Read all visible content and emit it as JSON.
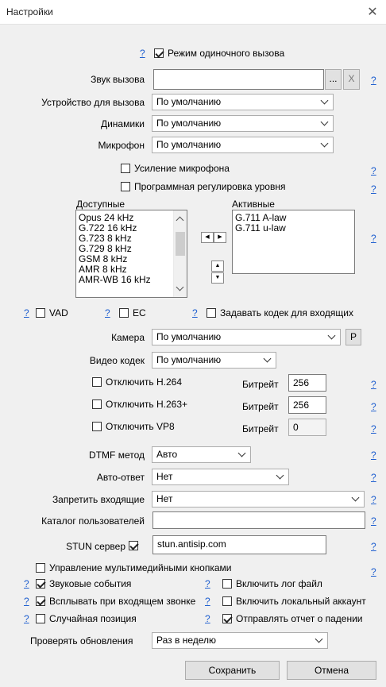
{
  "window": {
    "title": "Настройки"
  },
  "help": "?",
  "single_call": {
    "label": "Режим одиночного вызова",
    "checked": true
  },
  "call_sound": {
    "label": "Звук вызова",
    "value": "",
    "browse": "...",
    "clear": "X"
  },
  "call_device": {
    "label": "Устройство для вызова",
    "value": "По умолчанию"
  },
  "speakers": {
    "label": "Динамики",
    "value": "По умолчанию"
  },
  "microphone": {
    "label": "Микрофон",
    "value": "По умолчанию"
  },
  "mic_boost": {
    "label": "Усиление микрофона",
    "checked": false
  },
  "agc": {
    "label": "Программная регулировка уровня",
    "checked": false
  },
  "codecs": {
    "available_label": "Доступные",
    "active_label": "Активные",
    "available": [
      "Opus 24 kHz",
      "G.722 16 kHz",
      "G.723 8 kHz",
      "G.729 8 kHz",
      "GSM 8 kHz",
      "AMR 8 kHz",
      "AMR-WB 16 kHz"
    ],
    "active": [
      "G.711 A-law",
      "G.711 u-law"
    ]
  },
  "vad": {
    "label": "VAD",
    "checked": false
  },
  "ec": {
    "label": "EC",
    "checked": false
  },
  "incoming_codec": {
    "label": "Задавать кодек для входящих",
    "checked": false
  },
  "camera": {
    "label": "Камера",
    "value": "По умолчанию",
    "button": "P"
  },
  "video_codec": {
    "label": "Видео кодек",
    "value": "По умолчанию"
  },
  "disable_h264": {
    "label": "Отключить H.264",
    "checked": false,
    "bitrate_label": "Битрейт",
    "bitrate": "256"
  },
  "disable_h263": {
    "label": "Отключить H.263+",
    "checked": false,
    "bitrate_label": "Битрейт",
    "bitrate": "256"
  },
  "disable_vp8": {
    "label": "Отключить VP8",
    "checked": false,
    "bitrate_label": "Битрейт",
    "bitrate": "0"
  },
  "dtmf": {
    "label": "DTMF метод",
    "value": "Авто"
  },
  "auto_answer": {
    "label": "Авто-ответ",
    "value": "Нет"
  },
  "block_incoming": {
    "label": "Запретить входящие",
    "value": "Нет"
  },
  "user_dir": {
    "label": "Каталог пользователей",
    "value": ""
  },
  "stun": {
    "label": "STUN сервер",
    "checked": true,
    "value": "stun.antisip.com"
  },
  "media_keys": {
    "label": "Управление мультимедийными кнопками",
    "checked": false
  },
  "sound_events": {
    "label": "Звуковые события",
    "checked": true
  },
  "enable_log": {
    "label": "Включить лог файл",
    "checked": false
  },
  "popup_incoming": {
    "label": "Всплывать при входящем звонке",
    "checked": true
  },
  "local_account": {
    "label": "Включить локальный аккаунт",
    "checked": false
  },
  "random_pos": {
    "label": "Случайная позиция",
    "checked": false
  },
  "crash_report": {
    "label": "Отправлять отчет о падении",
    "checked": true
  },
  "updates": {
    "label": "Проверять обновления",
    "value": "Раз в неделю"
  },
  "buttons": {
    "save": "Сохранить",
    "cancel": "Отмена"
  }
}
